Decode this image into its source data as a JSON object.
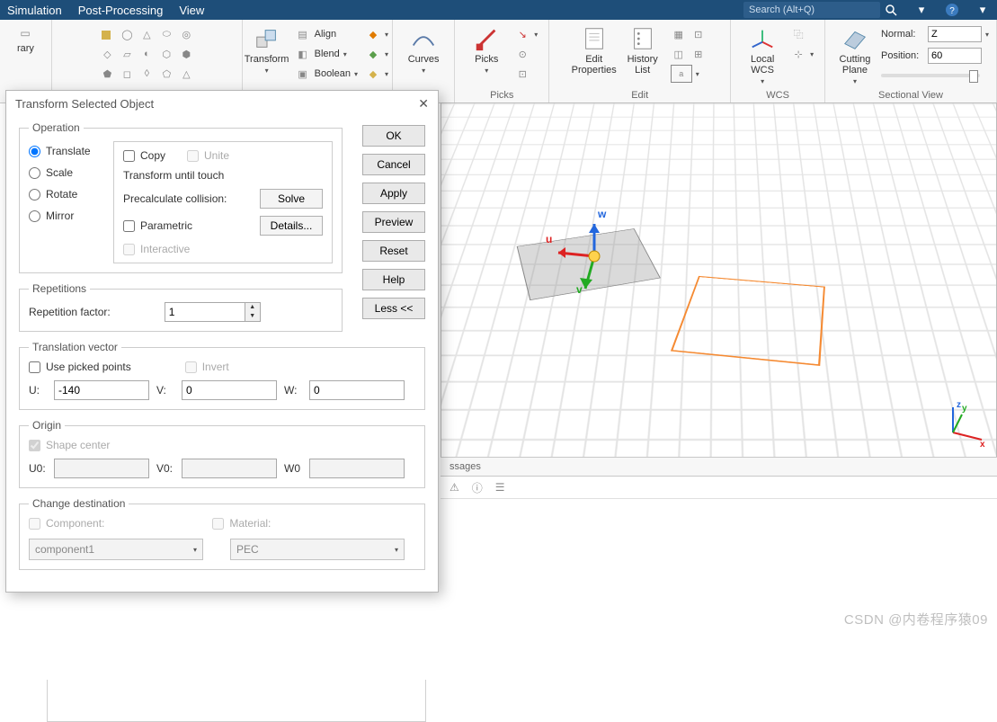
{
  "menubar": {
    "items": [
      "Simulation",
      "Post-Processing",
      "View"
    ],
    "search_placeholder": "Search (Alt+Q)"
  },
  "ribbon": {
    "library_label": "rary",
    "transform": {
      "btn": "Transform",
      "align": "Align",
      "blend": "Blend",
      "boolean": "Boolean"
    },
    "curves": "Curves",
    "picks": {
      "btn": "Picks",
      "group": "Picks"
    },
    "edit": {
      "props": "Edit\nProperties",
      "hist": "History\nList",
      "group": "Edit"
    },
    "wcs": {
      "btn": "Local\nWCS",
      "group": "WCS"
    },
    "sectional": {
      "btn": "Cutting\nPlane",
      "normal_lbl": "Normal:",
      "normal_val": "Z",
      "position_lbl": "Position:",
      "position_val": "60",
      "group": "Sectional View"
    }
  },
  "dialog": {
    "title": "Transform Selected Object",
    "operation": {
      "legend": "Operation",
      "translate": "Translate",
      "scale": "Scale",
      "rotate": "Rotate",
      "mirror": "Mirror",
      "copy": "Copy",
      "unite": "Unite",
      "tut": "Transform until touch",
      "precalc": "Precalculate collision:",
      "solve": "Solve",
      "details": "Details...",
      "parametric": "Parametric",
      "interactive": "Interactive"
    },
    "buttons": {
      "ok": "OK",
      "cancel": "Cancel",
      "apply": "Apply",
      "preview": "Preview",
      "reset": "Reset",
      "help": "Help",
      "less": "Less <<"
    },
    "rep": {
      "legend": "Repetitions",
      "factor_lbl": "Repetition factor:",
      "factor_val": "1"
    },
    "tv": {
      "legend": "Translation vector",
      "use_picked": "Use picked points",
      "invert": "Invert",
      "u_lbl": "U:",
      "u": "-140",
      "v_lbl": "V:",
      "v": "0",
      "w_lbl": "W:",
      "w": "0"
    },
    "origin": {
      "legend": "Origin",
      "shape_center": "Shape center",
      "u0": "U0:",
      "v0": "V0:",
      "w0": "W0"
    },
    "dest": {
      "legend": "Change destination",
      "component": "Component:",
      "material": "Material:",
      "component_val": "component1",
      "material_val": "PEC"
    }
  },
  "viewport": {
    "u": "u",
    "v": "v",
    "w": "w",
    "x": "x",
    "y": "y",
    "z": "z"
  },
  "messages": {
    "tab": "ssages"
  },
  "watermark": "CSDN @内卷程序猿09"
}
